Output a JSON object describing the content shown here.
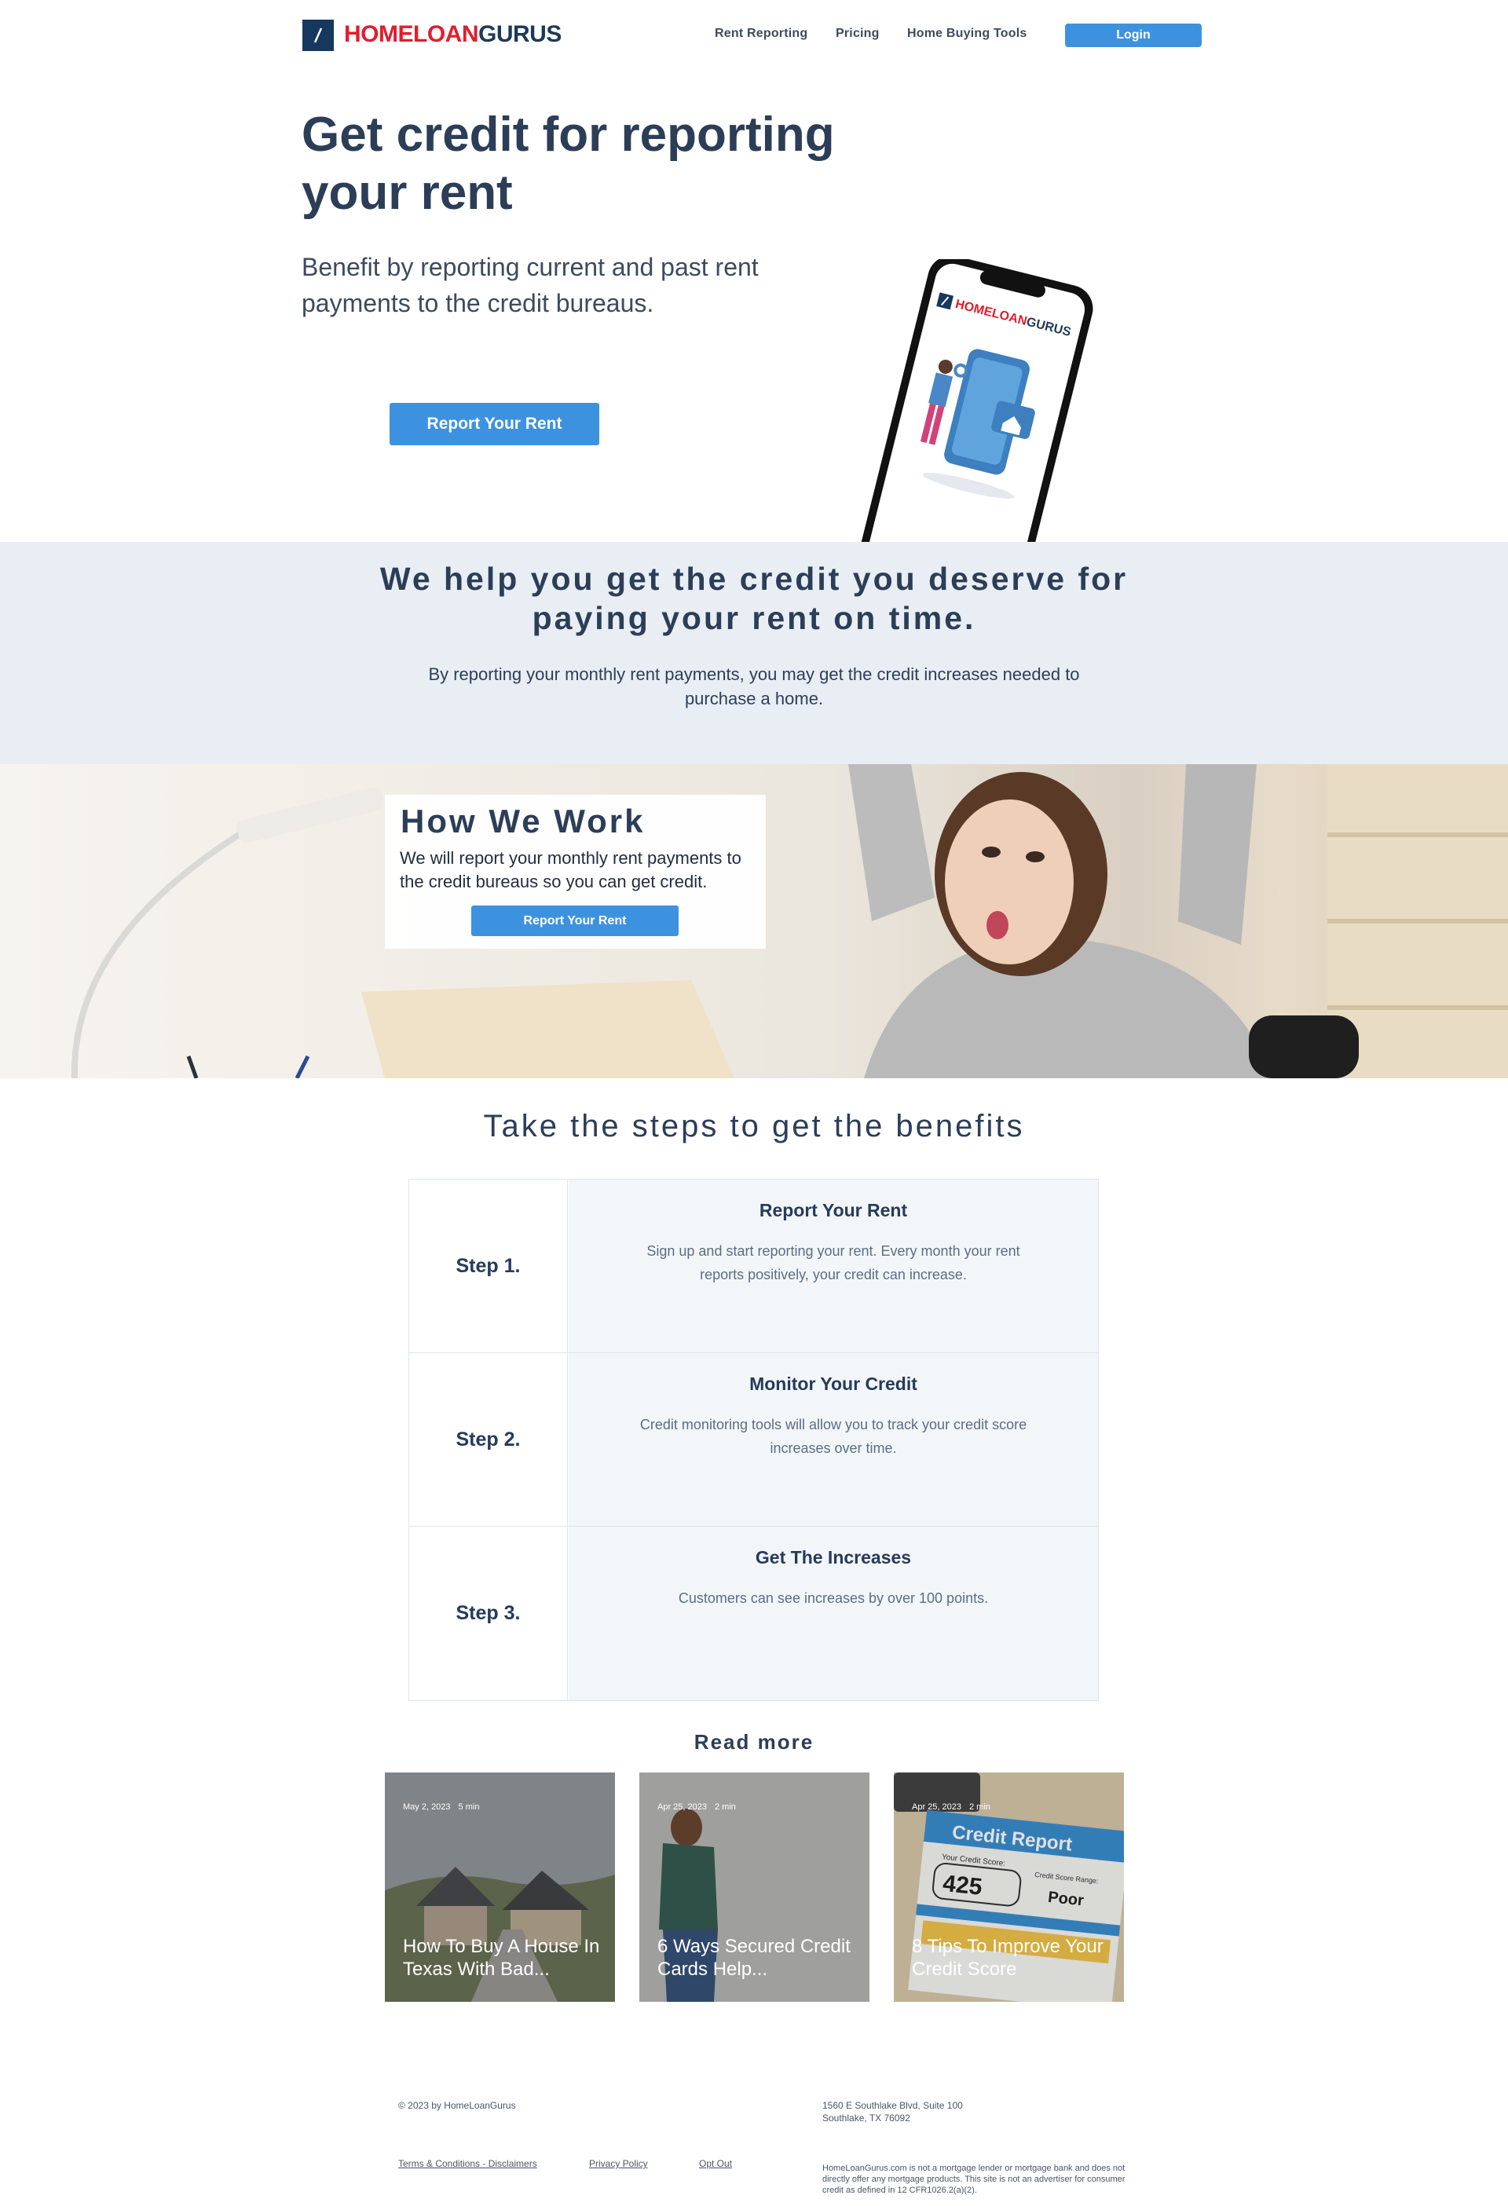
{
  "header": {
    "logo_red": "HOMELOAN",
    "logo_navy": "GURUS",
    "nav": [
      "Rent Reporting",
      "Pricing",
      "Home Buying Tools"
    ],
    "login": "Login"
  },
  "hero": {
    "title": "Get credit for reporting your rent",
    "subtitle": "Benefit by reporting current and past rent payments to the credit bureaus.",
    "button": "Report Your Rent",
    "phone_logo_red": "HOMELOAN",
    "phone_logo_navy": "GURUS"
  },
  "band": {
    "title": "We help you get the credit you deserve for paying your rent on time.",
    "subtitle": "By reporting your monthly rent payments, you may get the credit increases needed to purchase a home."
  },
  "how_we_work": {
    "title": "How We Work",
    "text": "We will report your monthly rent payments to the credit bureaus so you can get credit.",
    "button": "Report Your Rent"
  },
  "steps": {
    "title": "Take the steps to get the benefits",
    "items": [
      {
        "label": "Step 1.",
        "head": "Report Your Rent",
        "desc": "Sign up and start reporting your rent. Every month your rent reports positively, your credit can increase."
      },
      {
        "label": "Step 2.",
        "head": "Monitor Your Credit",
        "desc": "Credit monitoring tools will allow you to track your credit score increases over time."
      },
      {
        "label": "Step 3.",
        "head": "Get The Increases",
        "desc": "Customers can see increases by over 100 points."
      }
    ]
  },
  "read_more": {
    "title": "Read more",
    "posts": [
      {
        "date": "May 2, 2023",
        "read": "5 min",
        "title": "How To Buy A House In Texas With Bad..."
      },
      {
        "date": "Apr 25, 2023",
        "read": "2 min",
        "title": "6 Ways Secured Credit Cards Help..."
      },
      {
        "date": "Apr 25, 2023",
        "read": "2 min",
        "title": "8 Tips To Improve Your Credit Score"
      }
    ],
    "credit_report": {
      "heading": "Credit Report",
      "score_label": "Your Credit Score:",
      "score": "425",
      "range_label": "Credit Score Range:",
      "range": "Poor"
    }
  },
  "footer": {
    "copyright": "© 2023 by HomeLoanGurus",
    "links": [
      "Terms & Conditions - Disclaimers",
      "Privacy Policy",
      "Opt Out"
    ],
    "address_1": "1560 E Southlake Blvd, Suite 100",
    "address_2": "Southlake, TX 76092",
    "disclaimer": "HomeLoanGurus.com is not a mortgage lender or mortgage bank and does not directly offer any mortgage products. This site is not an advertiser for consumer credit as defined in 12 CFR1026.2(a)(2)."
  },
  "colors": {
    "accent": "#3d92e0",
    "brand_red": "#e21d2d",
    "navy": "#1e3859",
    "band": "#e8eef4"
  }
}
